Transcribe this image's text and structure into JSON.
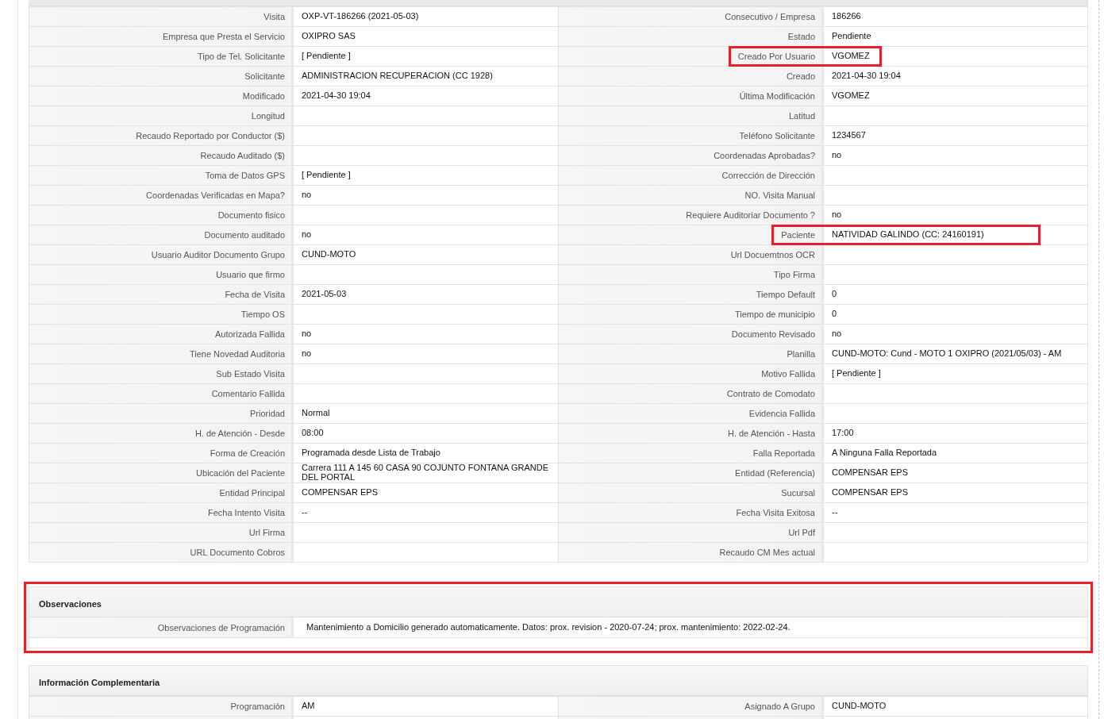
{
  "details": {
    "rows": [
      {
        "left": {
          "label": "Visita",
          "value": "OXP-VT-186266 (2021-05-03)",
          "highlighted": false
        },
        "right": {
          "label": "Consecutivo / Empresa",
          "value": "186266",
          "highlighted": false
        }
      },
      {
        "left": {
          "label": "Empresa que Presta el Servicio",
          "value": "OXIPRO SAS",
          "highlighted": false
        },
        "right": {
          "label": "Estado",
          "value": "Pendiente",
          "highlighted": false
        }
      },
      {
        "left": {
          "label": "Tipo de Tel. Solicitante",
          "value": "[ Pendiente ]",
          "highlighted": false
        },
        "right": {
          "label": "Creado Por Usuario",
          "value": "VGOMEZ",
          "highlighted": true
        }
      },
      {
        "left": {
          "label": "Solicitante",
          "value": "ADMINISTRACION RECUPERACION (CC 1928)",
          "highlighted": false
        },
        "right": {
          "label": "Creado",
          "value": "2021-04-30 19:04",
          "highlighted": false
        }
      },
      {
        "left": {
          "label": "Modificado",
          "value": "2021-04-30 19:04",
          "highlighted": false
        },
        "right": {
          "label": "Última Modificación",
          "value": "VGOMEZ",
          "highlighted": false
        }
      },
      {
        "left": {
          "label": "Longitud",
          "highlighted": false
        },
        "right": {
          "label": "Latitud",
          "highlighted": false
        }
      },
      {
        "left": {
          "label": "Recaudo Reportado por Conductor ($)",
          "highlighted": false
        },
        "right": {
          "label": "Teléfono Solicitante",
          "value": "1234567",
          "highlighted": false
        }
      },
      {
        "left": {
          "label": "Recaudo Auditado ($)",
          "highlighted": false
        },
        "right": {
          "label": "Coordenadas Aprobadas?",
          "value": "no",
          "highlighted": false
        }
      },
      {
        "left": {
          "label": "Toma de Datos GPS",
          "value": "[ Pendiente ]",
          "highlighted": false
        },
        "right": {
          "label": "Corrección de Dirección",
          "highlighted": false
        }
      },
      {
        "left": {
          "label": "Coordenadas Verificadas en Mapa?",
          "value": "no",
          "highlighted": false
        },
        "right": {
          "label": "NO. Visita Manual",
          "highlighted": false
        }
      },
      {
        "left": {
          "label": "Documento fisico",
          "highlighted": false
        },
        "right": {
          "label": "Requiere Auditoriar Documento ?",
          "value": "no",
          "highlighted": false
        }
      },
      {
        "left": {
          "label": "Documento auditado",
          "value": "no",
          "highlighted": false
        },
        "right": {
          "label": "Paciente",
          "value": "NATIVIDAD GALINDO (CC: 24160191)",
          "highlighted": true
        }
      },
      {
        "left": {
          "label": "Usuario Auditor Documento Grupo",
          "value": "CUND-MOTO",
          "highlighted": false
        },
        "right": {
          "label": "Url Docuemtnos OCR",
          "highlighted": false
        }
      },
      {
        "left": {
          "label": "Usuario que firmo",
          "highlighted": false
        },
        "right": {
          "label": "Tipo Firma",
          "highlighted": false
        }
      },
      {
        "left": {
          "label": "Fecha de Visita",
          "value": "2021-05-03",
          "highlighted": false
        },
        "right": {
          "label": "Tiempo Default",
          "value": "0",
          "highlighted": false
        }
      },
      {
        "left": {
          "label": "Tiempo OS",
          "highlighted": false
        },
        "right": {
          "label": "Tiempo de municipio",
          "value": "0",
          "highlighted": false
        }
      },
      {
        "left": {
          "label": "Autorizada Fallida",
          "value": "no",
          "highlighted": false
        },
        "right": {
          "label": "Documento Revisado",
          "value": "no",
          "highlighted": false
        }
      },
      {
        "left": {
          "label": "Tiene Novedad Auditoria",
          "value": "no",
          "highlighted": false
        },
        "right": {
          "label": "Planilla",
          "value": "CUND-MOTO: Cund - MOTO 1 OXIPRO (2021/05/03) - AM",
          "highlighted": false
        }
      },
      {
        "left": {
          "label": "Sub Estado Visita",
          "highlighted": false
        },
        "right": {
          "label": "Motivo Fallida",
          "value": "[ Pendiente ]",
          "highlighted": false
        }
      },
      {
        "left": {
          "label": "Comentario Fallida",
          "highlighted": false
        },
        "right": {
          "label": "Contrato de Comodato",
          "highlighted": false
        }
      },
      {
        "left": {
          "label": "Prioridad",
          "value": "Normal",
          "highlighted": false
        },
        "right": {
          "label": "Evidencia Fallida",
          "highlighted": false
        }
      },
      {
        "left": {
          "label": "H. de Atención - Desde",
          "value": "08:00",
          "highlighted": false
        },
        "right": {
          "label": "H. de Atención - Hasta",
          "value": "17:00",
          "highlighted": false
        }
      },
      {
        "left": {
          "label": "Forma de Creación",
          "value": "Programada desde Lista de Trabajo",
          "highlighted": false
        },
        "right": {
          "label": "Falla Reportada",
          "value": "A Ninguna Falla Reportada",
          "highlighted": false
        }
      },
      {
        "left": {
          "label": "Ubicación del Paciente",
          "value": "Carrera 111 A 145 60 CASA 90 COJUNTO FONTANA GRANDE DEL PORTAL",
          "highlighted": false
        },
        "right": {
          "label": "Entidad (Referencia)",
          "value": "COMPENSAR EPS",
          "highlighted": false
        }
      },
      {
        "left": {
          "label": "Entidad Principal",
          "value": "COMPENSAR EPS",
          "highlighted": false
        },
        "right": {
          "label": "Sucursal",
          "value": "COMPENSAR EPS",
          "highlighted": false
        }
      },
      {
        "left": {
          "label": "Fecha Intento Visita",
          "value": "--",
          "highlighted": false
        },
        "right": {
          "label": "Fecha Visita Exitosa",
          "value": "--",
          "highlighted": false
        }
      },
      {
        "left": {
          "label": "Url Firma",
          "highlighted": false
        },
        "right": {
          "label": "Url Pdf",
          "highlighted": false
        }
      },
      {
        "left": {
          "label": "URL Documento Cobros",
          "highlighted": false
        },
        "right": {
          "label": "Recaudo CM Mes actual",
          "highlighted": false
        }
      }
    ]
  },
  "observaciones": {
    "title": "Observaciones",
    "highlighted": true,
    "label": "Observaciones de Programación",
    "value": "Mantenimiento a Domicilio generado automaticamente. Datos: prox. revision - 2020-07-24; prox. mantenimiento: 2022-02-24."
  },
  "informacion_complementaria": {
    "title": "Información Complementaria",
    "rows": [
      {
        "left": {
          "label": "Programación",
          "value": "AM"
        },
        "right": {
          "label": "Asignado A Grupo",
          "value": "CUND-MOTO"
        }
      }
    ]
  }
}
